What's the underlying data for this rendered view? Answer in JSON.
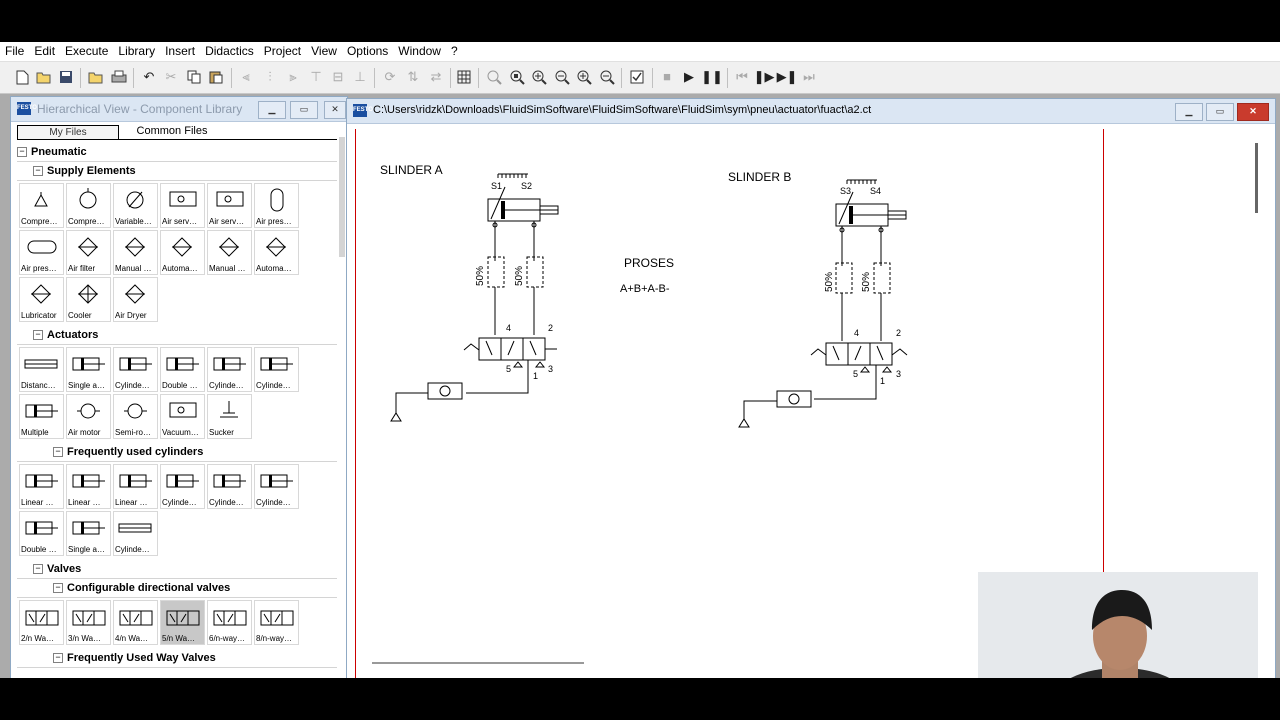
{
  "menu": [
    "File",
    "Edit",
    "Execute",
    "Library",
    "Insert",
    "Didactics",
    "Project",
    "View",
    "Options",
    "Window",
    "?"
  ],
  "toolbar_icons": [
    "new-icon",
    "open-icon",
    "save-icon",
    "open-folder-icon",
    "print-icon",
    "undo-icon",
    "cut-icon",
    "copy-icon",
    "paste-icon",
    "align-left-icon",
    "align-center-icon",
    "align-right-icon",
    "align-top-icon",
    "align-middle-icon",
    "align-bottom-icon",
    "rotate-icon",
    "flip-icon",
    "mirror-icon",
    "grid-icon",
    "zoom-icon",
    "zoom-fit-icon",
    "zoom-window-icon",
    "zoom-previous-icon",
    "zoom-in-icon",
    "zoom-out-icon",
    "check-icon",
    "stop-icon",
    "play-icon",
    "pause-icon",
    "rewind-icon",
    "step-icon",
    "step-forward-icon",
    "fast-forward-icon"
  ],
  "library": {
    "title": "Hierarchical View - Component Library",
    "tabs": [
      "My Files",
      "Common Files"
    ],
    "groups": [
      {
        "name": "Pneumatic",
        "level": 0
      },
      {
        "name": "Supply Elements",
        "level": 1,
        "items": [
          "Compre…",
          "Compre…",
          "Variable…",
          "Air serv…",
          "Air serv…",
          "Air pres…",
          "Air pres…",
          "Air filter",
          "Manual …",
          "Automa…",
          "Manual …",
          "Automa…",
          "Lubricator",
          "Cooler",
          "Air Dryer"
        ]
      },
      {
        "name": "Actuators",
        "level": 1,
        "items": [
          "Distanc…",
          "Single a…",
          "Cylinde…",
          "Double …",
          "Cylinde…",
          "Cylinde…",
          "Multiple",
          "Air motor",
          "Semi-ro…",
          "Vacuum…",
          "Sucker"
        ]
      },
      {
        "name": "Frequently used cylinders",
        "level": 2,
        "items": [
          "Linear …",
          "Linear …",
          "Linear …",
          "Cylinde…",
          "Cylinde…",
          "Cylinde…",
          "Double …",
          "Single a…",
          "Cylinde…"
        ]
      },
      {
        "name": "Valves",
        "level": 1
      },
      {
        "name": "Configurable directional valves",
        "level": 2,
        "items": [
          "2/n Wa…",
          "3/n Wa…",
          "4/n Wa…",
          "5/n Wa…",
          "6/n-way…",
          "8/n-way…"
        ]
      },
      {
        "name": "Frequently Used Way Valves",
        "level": 2
      }
    ]
  },
  "document": {
    "title": "C:\\Users\\ridzk\\Downloads\\FluidSimSoftware\\FluidSimSoftware\\FluidSim\\sym\\pneu\\actuator\\fuact\\a2.ct",
    "slinder_a": "SLINDER  A",
    "slinder_b": "SLINDER  B",
    "proses": "PROSES",
    "sequence": "A+B+A-B-",
    "percent": "50%",
    "a_sensor_left": "S1",
    "a_sensor_right": "S2",
    "b_sensor_left": "S3",
    "b_sensor_right": "S4",
    "port_4": "4",
    "port_2": "2",
    "port_5": "5",
    "port_3": "3",
    "port_1": "1"
  },
  "colors": {
    "accent": "#c00000",
    "titlebar": "#dbe6f3",
    "close": "#c93b2d"
  }
}
